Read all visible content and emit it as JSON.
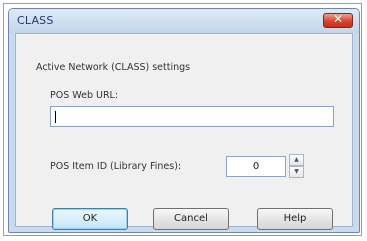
{
  "window": {
    "title": "CLASS",
    "close_symbol": "✕"
  },
  "form": {
    "heading": "Active Network (CLASS) settings",
    "pos_web_url_label": "POS Web URL:",
    "pos_web_url_value": "",
    "pos_item_id_label": "POS Item ID (Library Fines):",
    "pos_item_id_value": "0"
  },
  "buttons": {
    "ok": "OK",
    "cancel": "Cancel",
    "help": "Help"
  },
  "icons": {
    "close": "close-icon",
    "spin_up": "up-arrow-icon",
    "spin_down": "down-arrow-icon"
  }
}
